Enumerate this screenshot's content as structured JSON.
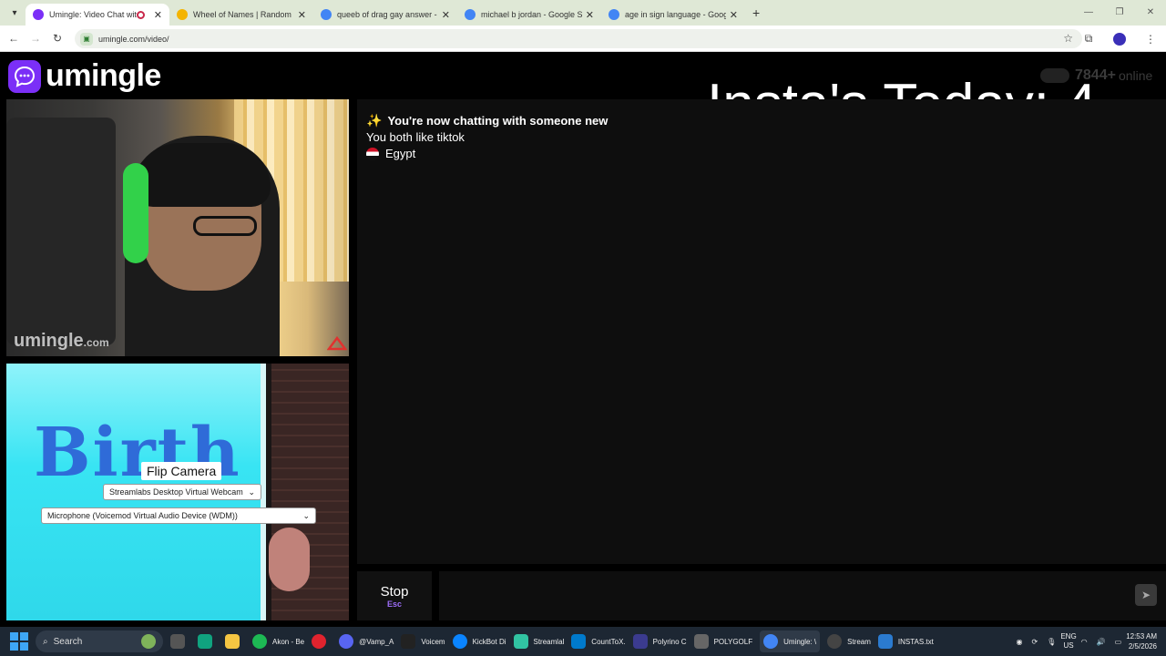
{
  "browser": {
    "tabs": [
      {
        "label": "Umingle: Video Chat with Strangers",
        "favicon_color": "#7b2ff7",
        "active": true
      },
      {
        "label": "Wheel of Names | Random name picker",
        "favicon_color": "#f4b400",
        "active": false
      },
      {
        "label": "queeb of drag gay answer - Google Search",
        "favicon_color": "#4285f4",
        "active": false
      },
      {
        "label": "michael b jordan - Google Search",
        "favicon_color": "#4285f4",
        "active": false
      },
      {
        "label": "age in sign language - Google Search",
        "favicon_color": "#4285f4",
        "active": false
      }
    ],
    "new_tab": "+",
    "url": "umingle.com/video/"
  },
  "page": {
    "logo_text": "umingle",
    "online_count": "7844+",
    "online_label": "online",
    "overlay_title": "Insta's Today:  4",
    "watermark_main": "umingle",
    "watermark_suffix": ".com",
    "self_video_text": "Birth",
    "flip_camera": "Flip Camera",
    "camera_select": "Streamlabs Desktop Virtual Webcam",
    "mic_select": "Microphone (Voicemod Virtual Audio Device (WDM))",
    "chat": {
      "line1": "You're now chatting with someone new",
      "line2": "You both like tiktok",
      "line3": "Egypt"
    },
    "stop_label": "Stop",
    "stop_key": "Esc"
  },
  "taskbar": {
    "search": "Search",
    "items": [
      {
        "label": "Akon - Be",
        "color": "#1db954"
      },
      {
        "label": "@Vamp_A",
        "color": "#5865f2"
      },
      {
        "label": "Voicem",
        "color": "#222"
      },
      {
        "label": "KickBot Di",
        "color": "#0a84ff"
      },
      {
        "label": "Streamlal",
        "color": "#31c3a2"
      },
      {
        "label": "CountToX.",
        "color": "#007acc"
      },
      {
        "label": "Polyrino C",
        "color": "#3b3b8f"
      },
      {
        "label": "POLYGOLF",
        "color": "#666"
      },
      {
        "label": "Umingle: \\",
        "color": "#4285f4"
      },
      {
        "label": "Stream",
        "color": "#444"
      },
      {
        "label": "INSTAS.txt",
        "color": "#2b7bd0"
      }
    ],
    "lang_top": "ENG",
    "lang_bottom": "US",
    "time": "12:53 AM",
    "date": "2/5/2026"
  }
}
